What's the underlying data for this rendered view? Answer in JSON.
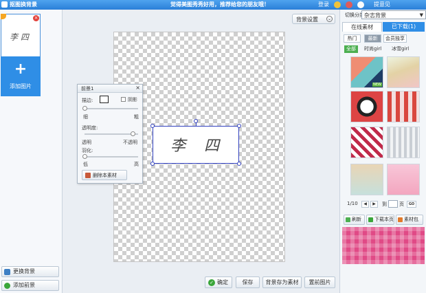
{
  "titlebar": {
    "app_title": "抠图换背景",
    "slogan": "觉得美图秀秀好用，推荐给您的朋友哦！",
    "login": "登录",
    "feedback": "提意见"
  },
  "left_panel": {
    "thumb_signature": "李 四",
    "add_image_label": "添加图片",
    "replace_bg_label": "更换背景",
    "add_bg_label": "添加前景"
  },
  "canvas": {
    "bg_settings_label": "背景设置",
    "signature_text": "李 四"
  },
  "float_panel": {
    "title": "前景1",
    "border_label": "描边:",
    "shadow_label": "阴影",
    "thin_label": "细",
    "thick_label": "粗",
    "opacity_label": "透明度:",
    "transparent_label": "透明",
    "opaque_label": "不透明",
    "feather_label": "羽化:",
    "low_label": "低",
    "high_label": "高",
    "delete_label": "删除本素材",
    "border_width": 0.0,
    "opacity": 1.0,
    "feather": 0.0
  },
  "bottom_toolbar": {
    "ok_label": "确定",
    "save_label": "保存",
    "save_material_label": "背景存为素材",
    "set_image_label": "置前图片"
  },
  "right_panel": {
    "switch_label": "切换分类",
    "category": "杂志背景",
    "tab_online": "在线素材",
    "tab_downloaded": "已下载(1)",
    "sub_hot": "热门",
    "sub_latest": "最新",
    "sub_vip": "会员独享",
    "cat_all": "全部",
    "cat_fashion": "时尚girl",
    "cat_snow": "冰雪girl",
    "new_badge": "NEW",
    "pager": {
      "page": "1/10",
      "goto_label": "到",
      "page_unit": "页",
      "go_label": "GO"
    },
    "refresh_label": "刷新",
    "download_page_label": "下载本页",
    "material_pack_label": "素材包"
  },
  "colors": {
    "titlebar": "#2a7fd8",
    "accent": "#2f8ee6",
    "selection": "#2f3fbf"
  }
}
